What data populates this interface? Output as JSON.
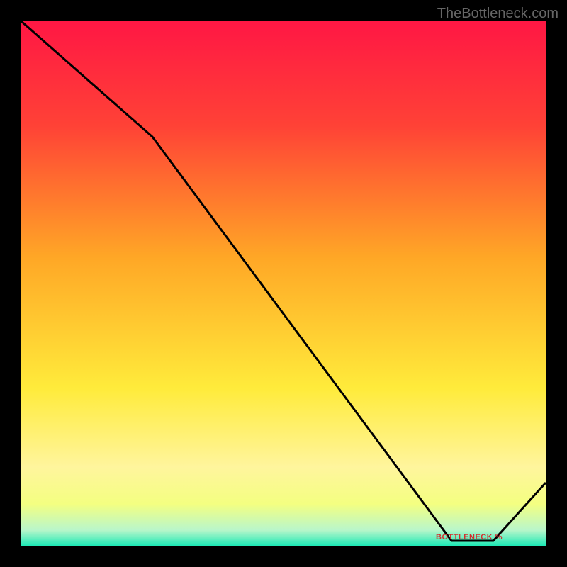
{
  "watermark": "TheBottleneck.com",
  "chart_data": {
    "type": "line",
    "title": "",
    "xlabel": "",
    "ylabel": "",
    "xlim": [
      0,
      100
    ],
    "ylim": [
      0,
      100
    ],
    "x": [
      0,
      25,
      82,
      90,
      100
    ],
    "values": [
      100,
      78,
      0,
      0,
      12
    ],
    "series_label": "BOTTLENECK %",
    "gradient_stops": [
      {
        "pos": 0,
        "color": "#ff1744"
      },
      {
        "pos": 20,
        "color": "#ff4236"
      },
      {
        "pos": 45,
        "color": "#ffa726"
      },
      {
        "pos": 70,
        "color": "#ffeb3b"
      },
      {
        "pos": 85,
        "color": "#fff59d"
      },
      {
        "pos": 92,
        "color": "#f4ff81"
      },
      {
        "pos": 97,
        "color": "#b9f6ca"
      },
      {
        "pos": 100,
        "color": "#1de9b6"
      }
    ]
  },
  "label": {
    "text": "BOTTLENECK %",
    "color": "#d32f2f"
  }
}
